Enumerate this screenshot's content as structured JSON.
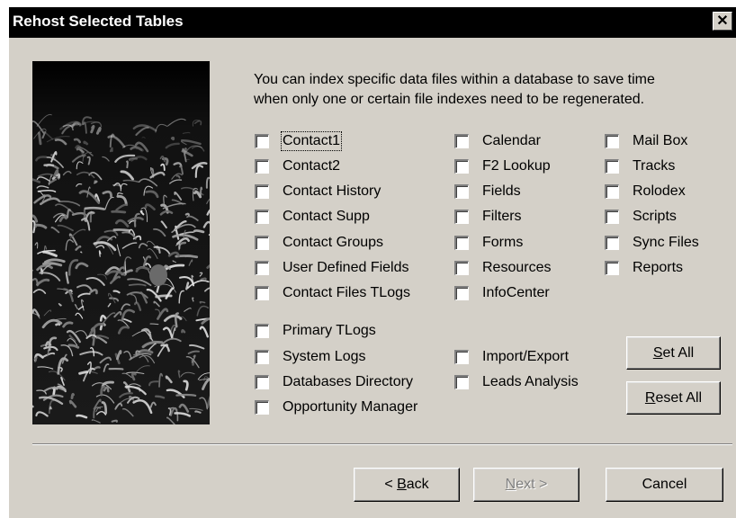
{
  "window": {
    "title": "Rehost Selected Tables",
    "close_glyph": "✕"
  },
  "intro": {
    "line1": "You can index specific data files within a database to save time",
    "line2": "when only one or certain file indexes need to be regenerated."
  },
  "tables": {
    "col1": [
      "Contact1",
      "Contact2",
      "Contact History",
      "Contact Supp",
      "Contact Groups",
      "User Defined Fields",
      "Contact Files TLogs"
    ],
    "col2": [
      "Calendar",
      "F2 Lookup",
      "Fields",
      "Filters",
      "Forms",
      "Resources",
      "InfoCenter"
    ],
    "col3": [
      "Mail Box",
      "Tracks",
      "Rolodex",
      "Scripts",
      "Sync Files",
      "Reports"
    ],
    "lower_col1": [
      "Primary TLogs",
      "System Logs",
      "Databases Directory",
      "Opportunity Manager"
    ],
    "lower_col2": [
      "Import/Export",
      "Leads Analysis"
    ]
  },
  "buttons": {
    "set_all_accel": "S",
    "set_all_rest": "et All",
    "reset_all_accel": "R",
    "reset_all_rest": "eset All",
    "back_pre": "< ",
    "back_accel": "B",
    "back_rest": "ack",
    "next_accel": "N",
    "next_rest": "ext >",
    "cancel": "Cancel"
  },
  "icons": {
    "close": "close-icon",
    "photo": "cornfield-photo"
  },
  "colors": {
    "dialog_bg": "#d4d0c8",
    "titlebar_bg": "#000000",
    "title_text": "#ffffff"
  }
}
